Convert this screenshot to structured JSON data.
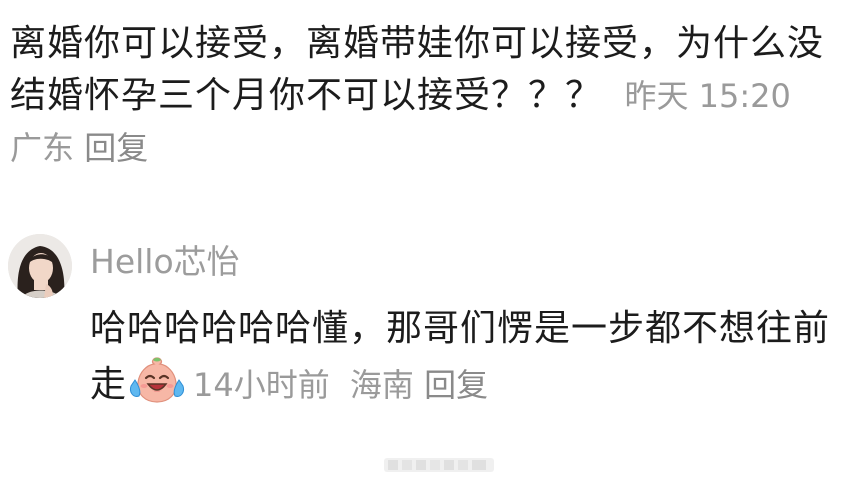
{
  "comment": {
    "text": "离婚你可以接受，离婚带娃你可以接受，为什么没结婚怀孕三个月你不可以接受？？？",
    "time": "昨天 15:20",
    "location": "广东",
    "reply_label": "回复"
  },
  "reply": {
    "username": "Hello芯怡",
    "text": "哈哈哈哈哈哈懂，那哥们愣是一步都不想往前走",
    "emoji_icon": "laughing-crying-emoji-icon",
    "time": "14小时前",
    "location": "海南",
    "reply_label": "回复"
  },
  "colors": {
    "text": "#1c1c1c",
    "meta": "#9a9a9a",
    "background": "#ffffff"
  }
}
